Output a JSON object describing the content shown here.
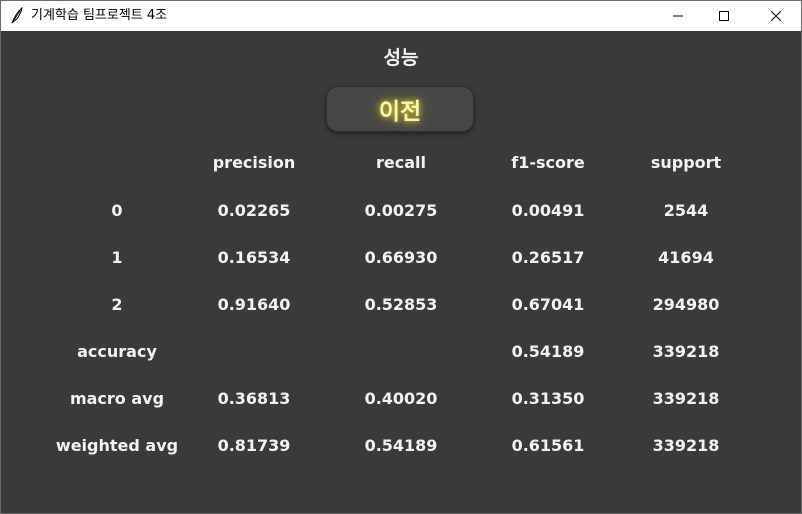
{
  "window": {
    "title": "기계학습 팀프로젝트 4조"
  },
  "page": {
    "heading": "성능",
    "prev_button_label": "이전"
  },
  "report": {
    "headers": [
      "precision",
      "recall",
      "f1-score",
      "support"
    ],
    "rows": [
      {
        "label": "0",
        "precision": "0.02265",
        "recall": "0.00275",
        "f1": "0.00491",
        "support": "2544"
      },
      {
        "label": "1",
        "precision": "0.16534",
        "recall": "0.66930",
        "f1": "0.26517",
        "support": "41694"
      },
      {
        "label": "2",
        "precision": "0.91640",
        "recall": "0.52853",
        "f1": "0.67041",
        "support": "294980"
      },
      {
        "label": "accuracy",
        "precision": "",
        "recall": "",
        "f1": "0.54189",
        "support": "339218"
      },
      {
        "label": "macro avg",
        "precision": "0.36813",
        "recall": "0.40020",
        "f1": "0.31350",
        "support": "339218"
      },
      {
        "label": "weighted avg",
        "precision": "0.81739",
        "recall": "0.54189",
        "f1": "0.61561",
        "support": "339218"
      }
    ]
  }
}
